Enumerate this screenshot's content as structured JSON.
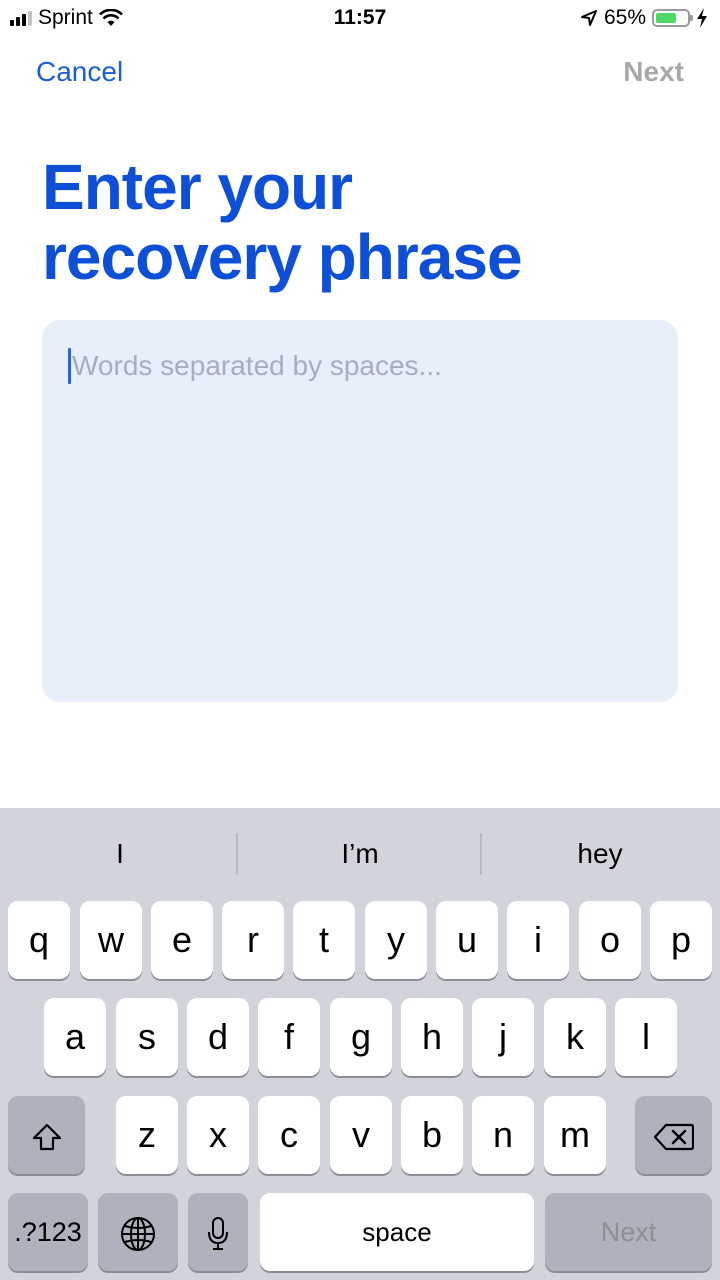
{
  "status_bar": {
    "carrier": "Sprint",
    "time": "11:57",
    "battery_percent": "65%",
    "battery_level": 0.65,
    "icons": [
      "signal-icon",
      "wifi-icon",
      "location-arrow-icon",
      "battery-icon",
      "charging-bolt-icon"
    ]
  },
  "nav": {
    "cancel_label": "Cancel",
    "next_label": "Next"
  },
  "title": {
    "line1": "Enter your",
    "line2": "recovery phrase"
  },
  "phrase_input": {
    "placeholder": "Words separated by spaces...",
    "value": ""
  },
  "keyboard": {
    "suggestions": [
      "I",
      "I’m",
      "hey"
    ],
    "row1": [
      "q",
      "w",
      "e",
      "r",
      "t",
      "y",
      "u",
      "i",
      "o",
      "p"
    ],
    "row2": [
      "a",
      "s",
      "d",
      "f",
      "g",
      "h",
      "j",
      "k",
      "l"
    ],
    "row3": [
      "z",
      "x",
      "c",
      "v",
      "b",
      "n",
      "m"
    ],
    "numbers_label": ".?123",
    "space_label": "space",
    "return_label": "Next",
    "icons": [
      "shift-icon",
      "backspace-icon",
      "globe-icon",
      "microphone-icon"
    ]
  },
  "colors": {
    "accent": "#1b5ed6",
    "title": "#0d4fd6",
    "input_bg": "#e8effb",
    "keyboard_bg": "#d1d4db",
    "disabled": "#a8a8a8"
  }
}
